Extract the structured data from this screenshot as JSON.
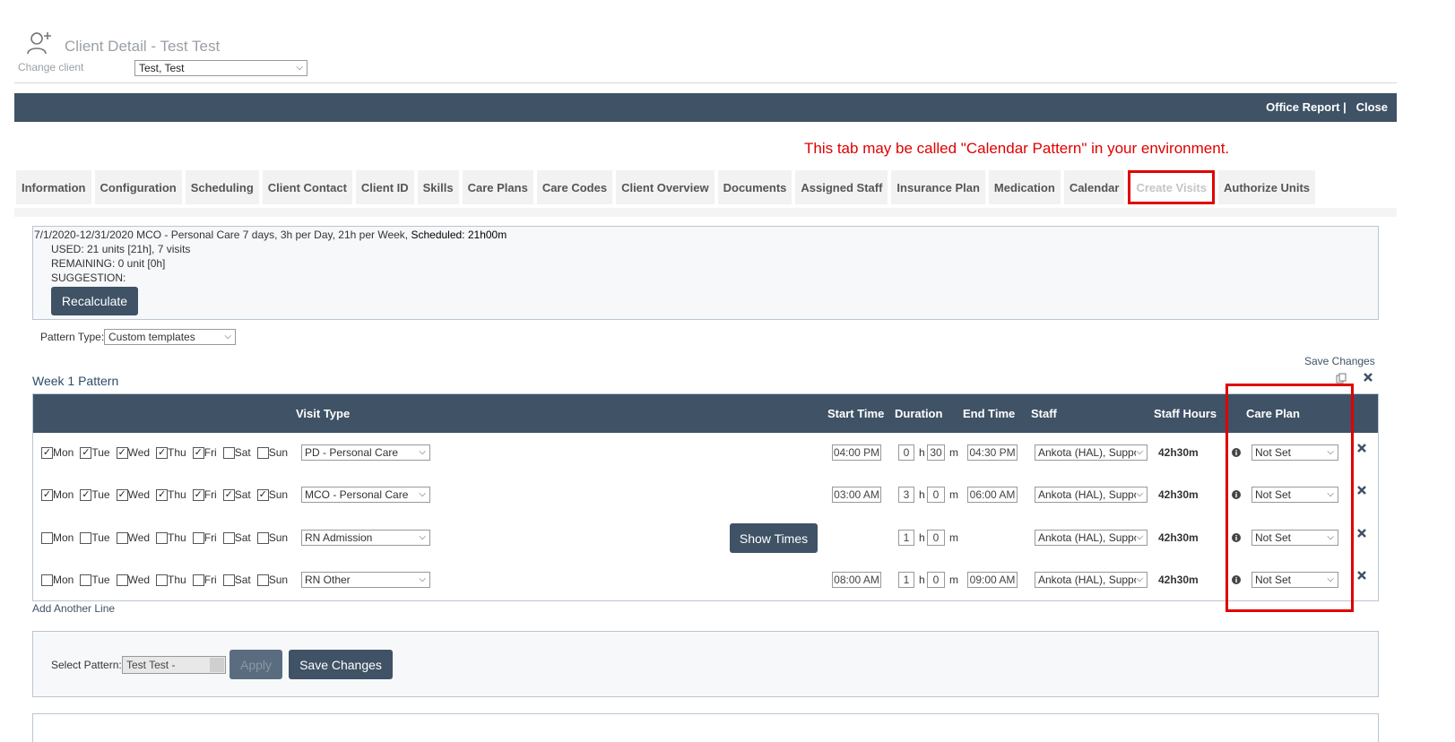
{
  "header": {
    "title": "Client Detail - Test Test",
    "change_client_label": "Change client",
    "client_select_value": "Test, Test",
    "icon": "user-plus-icon"
  },
  "topbar": {
    "office_report": "Office Report |",
    "close": "Close",
    "color": "#3f5266"
  },
  "annotation": {
    "text": "This tab may be called \"Calendar Pattern\" in your environment.",
    "color": "#e00000"
  },
  "tabs": [
    "Information",
    "Configuration",
    "Scheduling",
    "Client Contact",
    "Client ID",
    "Skills",
    "Care Plans",
    "Care Codes",
    "Client Overview",
    "Documents",
    "Assigned Staff",
    "Insurance Plan",
    "Medication",
    "Calendar",
    "Create Visits",
    "Authorize Units"
  ],
  "summary": {
    "line1": "7/1/2020-12/31/2020 MCO - Personal Care 7 days, 3h per Day, 21h per Week,",
    "scheduled": "Scheduled: 21h00m",
    "used": "USED: 21 units [21h], 7 visits",
    "remaining": "REMAINING: 0 unit [0h]",
    "suggestion": "SUGGESTION:",
    "recalculate": "Recalculate"
  },
  "pattern_type": {
    "label": "Pattern Type:",
    "value": "Custom templates"
  },
  "save_changes_link": "Save Changes",
  "week_title": "Week 1 Pattern",
  "columns": {
    "visit_type": "Visit Type",
    "start_time": "Start Time",
    "duration": "Duration",
    "end_time": "End Time",
    "staff": "Staff",
    "staff_hours": "Staff Hours",
    "care_plan": "Care Plan"
  },
  "day_labels": [
    "Mon",
    "Tue",
    "Wed",
    "Thu",
    "Fri",
    "Sat",
    "Sun"
  ],
  "rows": [
    {
      "days": [
        true,
        true,
        true,
        true,
        true,
        false,
        false
      ],
      "visit_type": "PD - Personal Care",
      "start": "04:00 PM",
      "dur_h": "0",
      "dur_m": "30",
      "end": "04:30 PM",
      "staff": "Ankota (HAL), Suppor",
      "hours": "42h30m",
      "care_plan": "Not Set"
    },
    {
      "days": [
        true,
        true,
        true,
        true,
        true,
        true,
        true
      ],
      "visit_type": "MCO - Personal Care",
      "start": "03:00 AM",
      "dur_h": "3",
      "dur_m": "0",
      "end": "06:00 AM",
      "staff": "Ankota (HAL), Suppor",
      "hours": "42h30m",
      "care_plan": "Not Set"
    },
    {
      "days": [
        false,
        false,
        false,
        false,
        false,
        false,
        false
      ],
      "visit_type": "RN Admission",
      "show_times": "Show Times",
      "dur_h": "1",
      "dur_m": "0",
      "staff": "Ankota (HAL), Suppor",
      "hours": "42h30m",
      "care_plan": "Not Set"
    },
    {
      "days": [
        false,
        false,
        false,
        false,
        false,
        false,
        false
      ],
      "visit_type": "RN Other",
      "start": "08:00 AM",
      "dur_h": "1",
      "dur_m": "0",
      "end": "09:00 AM",
      "staff": "Ankota (HAL), Suppor",
      "hours": "42h30m",
      "care_plan": "Not Set"
    }
  ],
  "units": {
    "h": "h",
    "m": "m"
  },
  "add_line": "Add Another Line",
  "bottom": {
    "select_label": "Select Pattern:",
    "select_value": "Test Test -",
    "apply": "Apply",
    "save": "Save Changes"
  }
}
